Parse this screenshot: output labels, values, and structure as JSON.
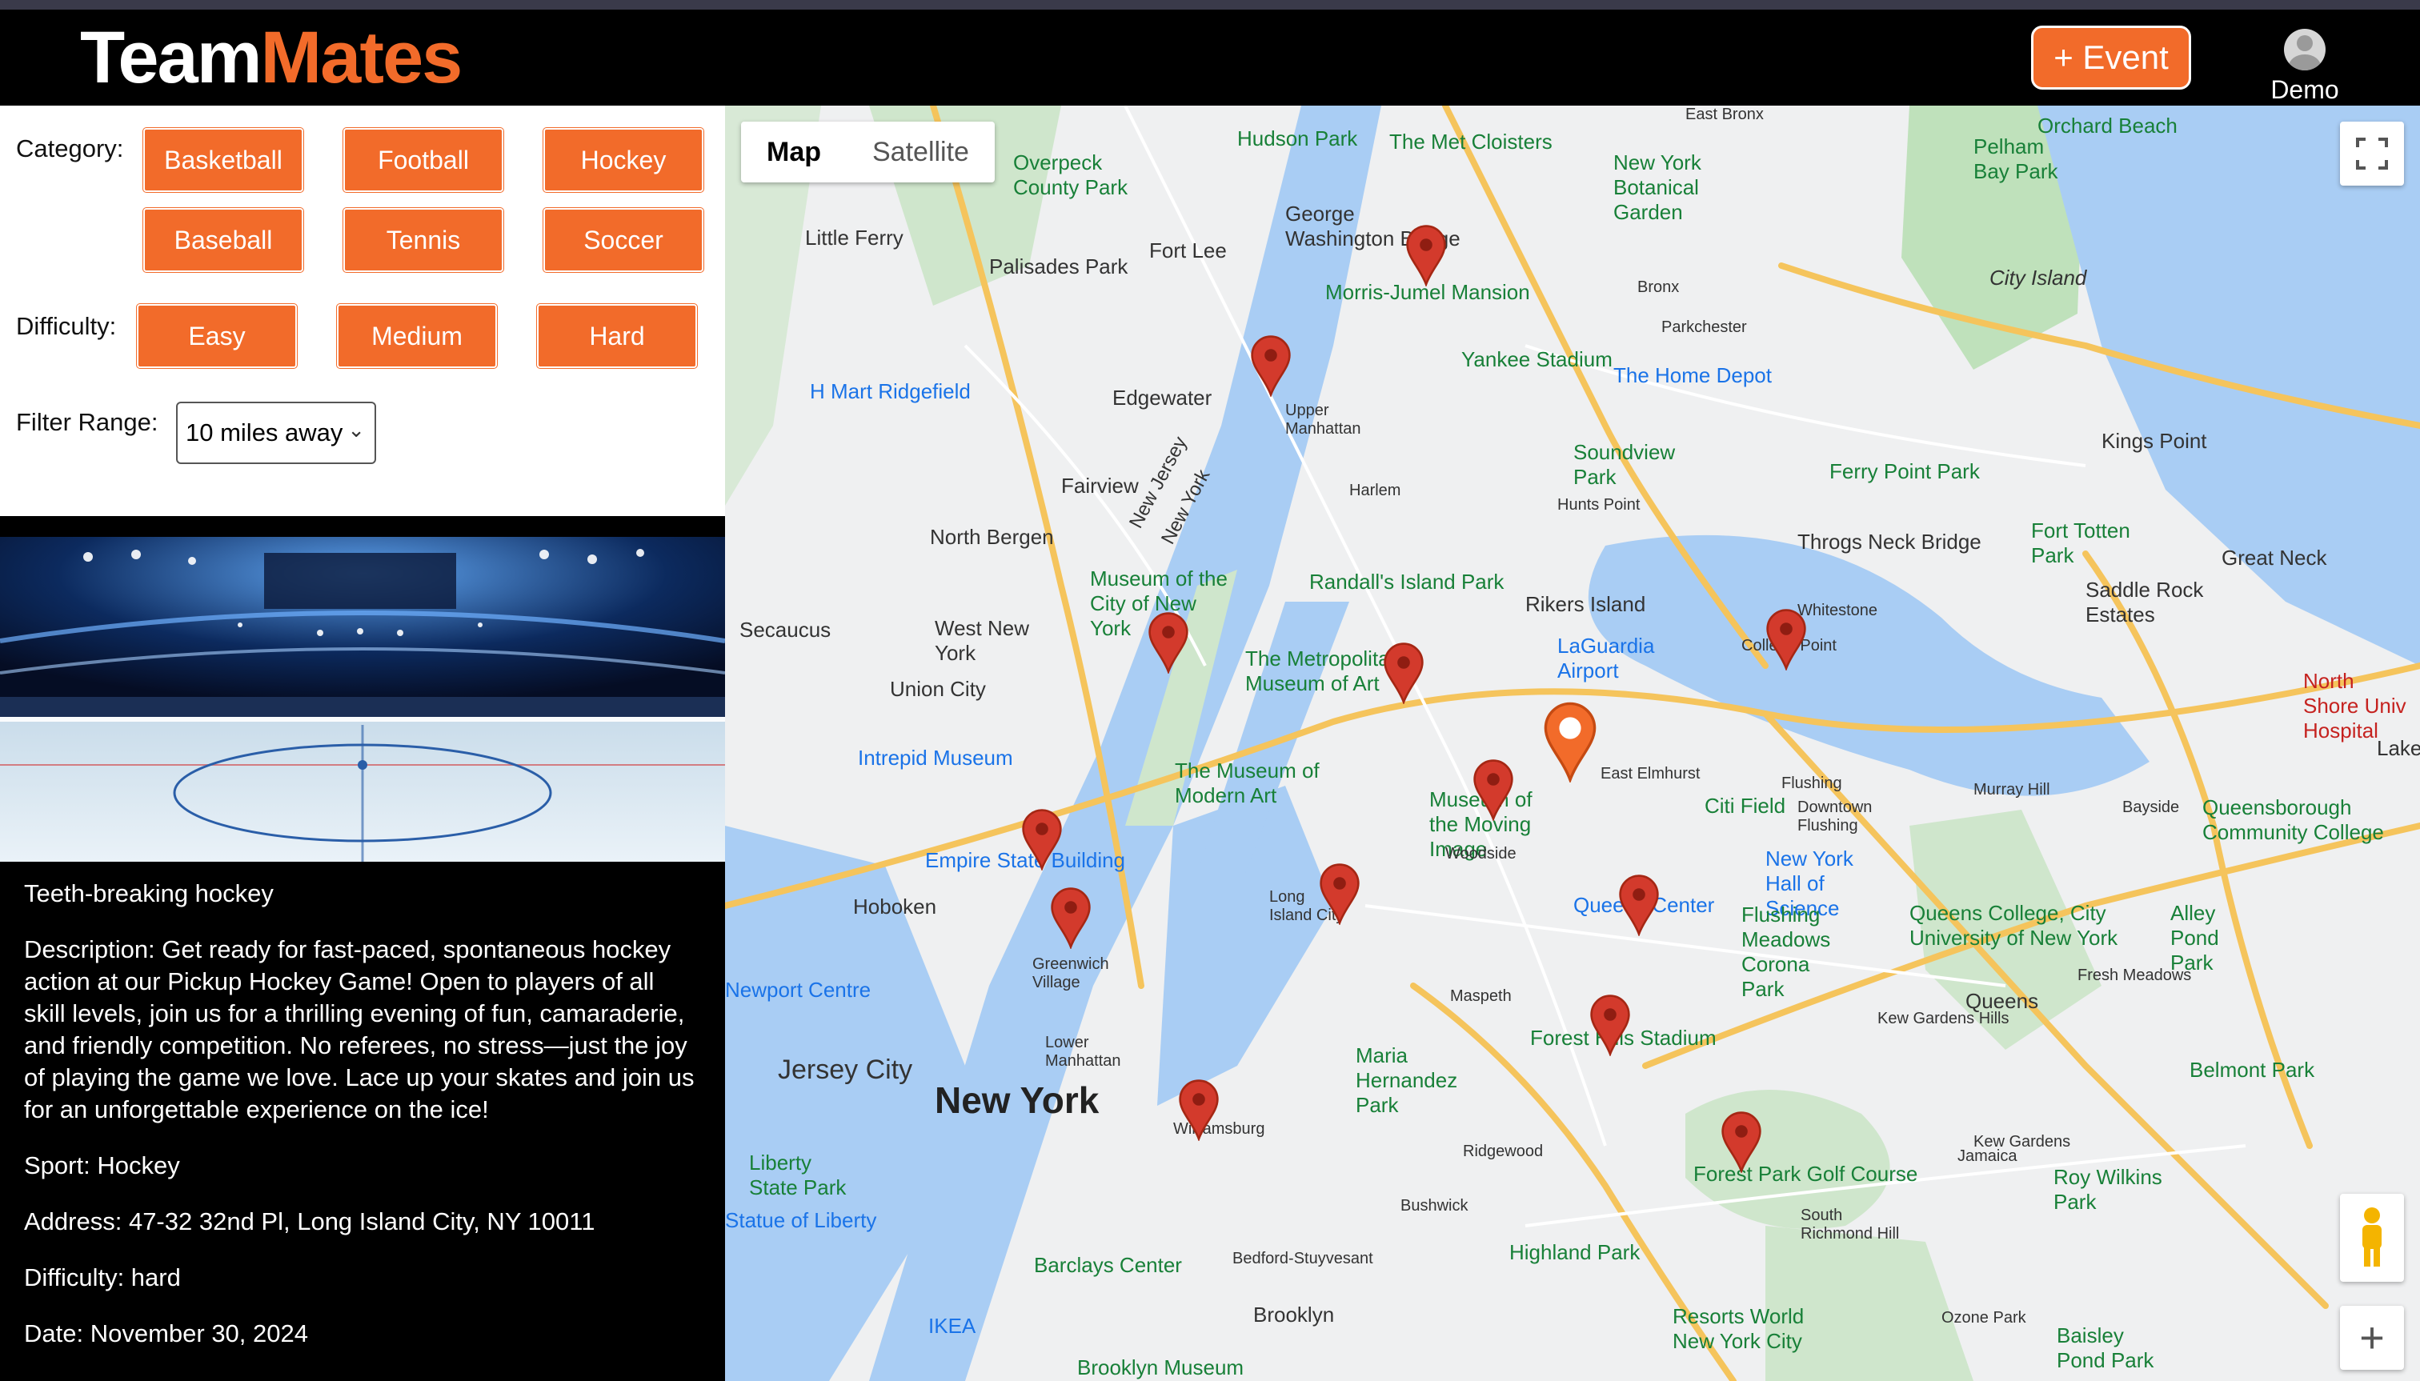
{
  "app": {
    "logo_part1": "Team",
    "logo_part2": "Mates",
    "event_button": "+ Event",
    "user_name": "Demo"
  },
  "filters": {
    "category_label": "Category:",
    "categories": [
      "Basketball",
      "Football",
      "Hockey",
      "Baseball",
      "Tennis",
      "Soccer"
    ],
    "difficulty_label": "Difficulty:",
    "difficulties": [
      "Easy",
      "Medium",
      "Hard"
    ],
    "range_label": "Filter Range:",
    "range_value": "10 miles away"
  },
  "event": {
    "title": "Teeth-breaking hockey",
    "description": "Description: Get ready for fast-paced, spontaneous hockey action at our Pickup Hockey Game! Open to players of all skill levels, join us for a thrilling evening of fun, camaraderie, and friendly competition. No referees, no stress—just the joy of playing the game we love. Lace up your skates and join us for an unforgettable experience on the ice!",
    "sport": "Sport: Hockey",
    "address": "Address: 47-32 32nd Pl, Long Island City, NY 10011",
    "difficulty": "Difficulty: hard",
    "date": "Date: November 30, 2024"
  },
  "map": {
    "tab_map": "Map",
    "tab_satellite": "Satellite",
    "labels": [
      "Hudson Park",
      "The Met Cloisters",
      "East Bronx",
      "Orchard Beach",
      "Pelham Bay Park",
      "Overpeck County Park",
      "George Washington Bridge",
      "New York Botanical Garden",
      "City Island",
      "Little Ferry",
      "Fort Lee",
      "Palisades Park",
      "Morris-Jumel Mansion",
      "Bronx",
      "Parkchester",
      "Yankee Stadium",
      "The Home Depot",
      "H Mart Ridgefield",
      "Edgewater",
      "Upper Manhattan",
      "Soundview Park",
      "Ferry Point Park",
      "Kings Point",
      "Fairview",
      "North Bergen",
      "Harlem",
      "Hunts Point",
      "Throgs Neck Bridge",
      "Fort Totten Park",
      "Great Neck",
      "Saddle Rock Estates",
      "Museum of the City of New York",
      "Randall's Island Park",
      "Rikers Island",
      "Secaucus",
      "West New York",
      "The Metropolitan Museum of Art",
      "LaGuardia Airport",
      "College Point",
      "Whitestone",
      "Union City",
      "Intrepid Museum",
      "The Museum of Modern Art",
      "East Elmhurst",
      "Citi Field",
      "Flushing",
      "Museum of the Moving Image",
      "Woodside",
      "Empire State Building",
      "Hoboken",
      "Long Island City",
      "Queens Center",
      "New York Hall of Science",
      "Flushing Meadows Corona Park",
      "Queens College, City University of New York",
      "Queensborough Community College",
      "Alley Pond Park",
      "Greenwich Village",
      "Maspeth",
      "Queens",
      "Lower Manhattan",
      "Forest Hills Stadium",
      "Jersey City",
      "New York",
      "Maria Hernandez Park",
      "Belmont Park",
      "Williamsburg",
      "Ridgewood",
      "Kew Gardens",
      "Jamaica",
      "Roy Wilkins Park",
      "Liberty State Park",
      "Forest Park Golf Course",
      "Bushwick",
      "South Richmond Hill",
      "Highland Park",
      "Barclays Center",
      "Bedford-Stuyvesant",
      "IKEA",
      "Brooklyn",
      "Resorts World New York City",
      "Baisley Pond Park",
      "Brooklyn Museum",
      "North Shore Univ Hospital",
      "Lake Suc",
      "Bayside",
      "Murray Hill",
      "Downtown Flushing",
      "Fresh Meadows",
      "Kew Gardens Hills",
      "Ozone Park",
      "Newport Centre",
      "Statue of Liberty",
      "New Jersey",
      "New York"
    ]
  }
}
